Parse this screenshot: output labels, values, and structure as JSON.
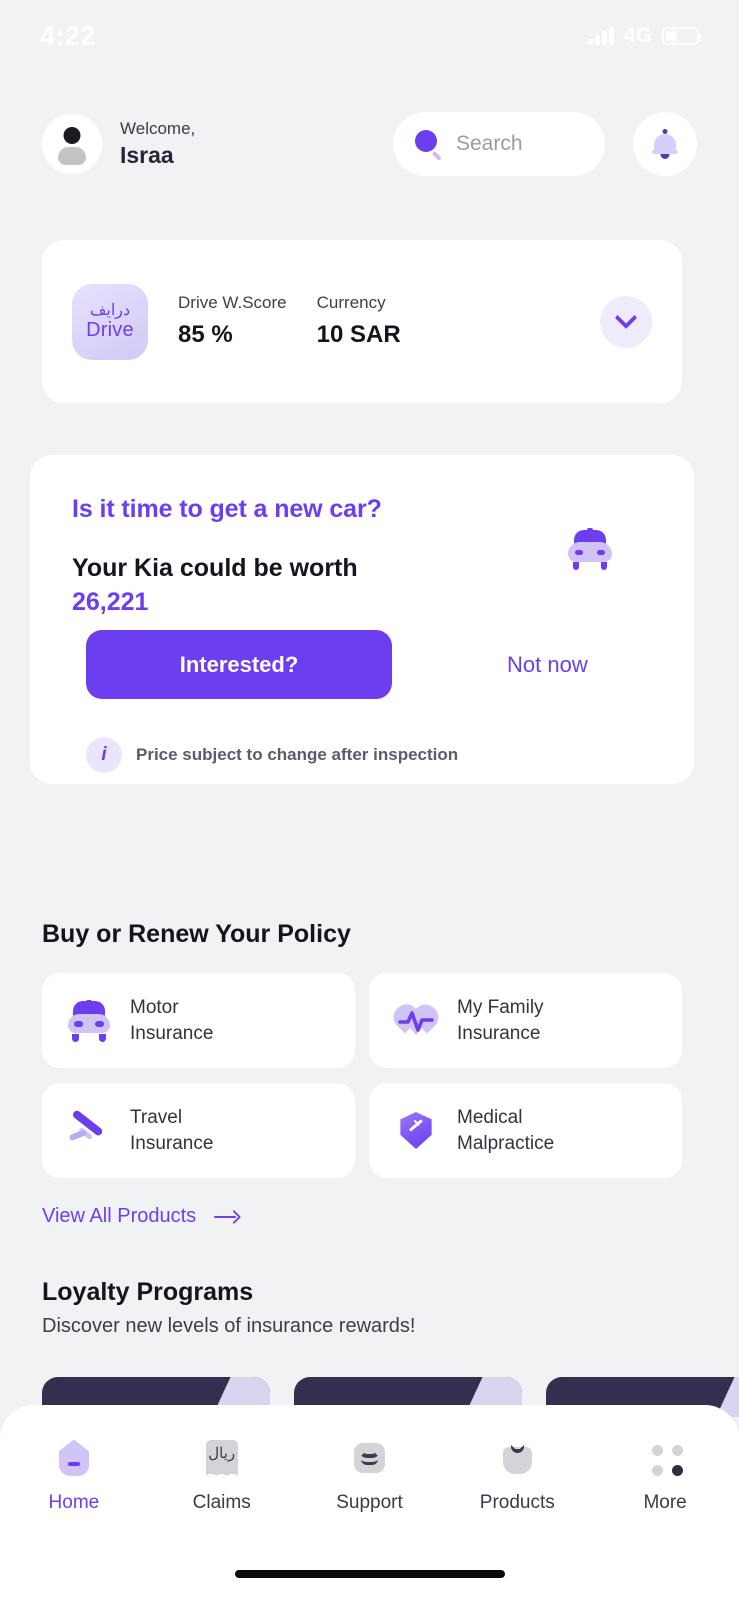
{
  "status_bar": {
    "time": "4:22",
    "network": "4G",
    "signal_icon": "signal-bars-icon",
    "battery_icon": "battery-icon"
  },
  "header": {
    "avatar_icon": "avatar-icon",
    "welcome_label": "Welcome,",
    "user_name": "Israa",
    "search": {
      "placeholder": "Search",
      "icon": "search-icon"
    },
    "notifications_icon": "bell-icon"
  },
  "drive_card": {
    "badge_arabic": "درايف",
    "badge_latin": "Drive",
    "stats": [
      {
        "label": "Drive W.Score",
        "value": "85 %"
      },
      {
        "label": "Currency",
        "value": "10 SAR"
      }
    ],
    "expand_icon": "chevron-down-icon"
  },
  "promo_card": {
    "question": "Is it time to get a new car?",
    "worth_line": "Your  Kia  could be worth",
    "amount": "26,221",
    "car_icon": "car-icon",
    "primary_button": "Interested?",
    "secondary_button": "Not now",
    "info_icon": "info-icon",
    "note": "Price subject to change after inspection"
  },
  "policy_section": {
    "title": "Buy or Renew Your Policy",
    "tiles": [
      {
        "label": "Motor\nInsurance",
        "line1": "Motor",
        "line2": "Insurance",
        "icon": "car-icon"
      },
      {
        "label": "My Family Insurance",
        "line1": "My Family",
        "line2": "Insurance",
        "icon": "heart-pulse-icon"
      },
      {
        "label": "Travel Insurance",
        "line1": "Travel",
        "line2": "Insurance",
        "icon": "airplane-icon"
      },
      {
        "label": "Medical Malpractice",
        "line1": "Medical",
        "line2": "Malpractice",
        "icon": "shield-syringe-icon"
      }
    ],
    "view_all": "View All Products",
    "view_all_icon": "arrow-right-icon"
  },
  "loyalty_section": {
    "title": "Loyalty Programs",
    "subtitle": "Discover new levels of insurance rewards!"
  },
  "bottom_nav": {
    "items": [
      {
        "label": "Home",
        "icon": "home-icon",
        "active": true
      },
      {
        "label": "Claims",
        "icon": "receipt-riyal-icon",
        "active": false
      },
      {
        "label": "Support",
        "icon": "envelope-icon",
        "active": false
      },
      {
        "label": "Products",
        "icon": "shopping-bag-icon",
        "active": false
      },
      {
        "label": "More",
        "icon": "grid-dots-icon",
        "active": false
      }
    ]
  },
  "colors": {
    "accent": "#6c3ef0",
    "accent_light": "#cfc4f5",
    "background": "#f1f2f4",
    "card": "#ffffff",
    "text_dark": "#14141f",
    "loyalty_card": "#332f4f",
    "loyalty_corner": "#d8d5ee"
  }
}
